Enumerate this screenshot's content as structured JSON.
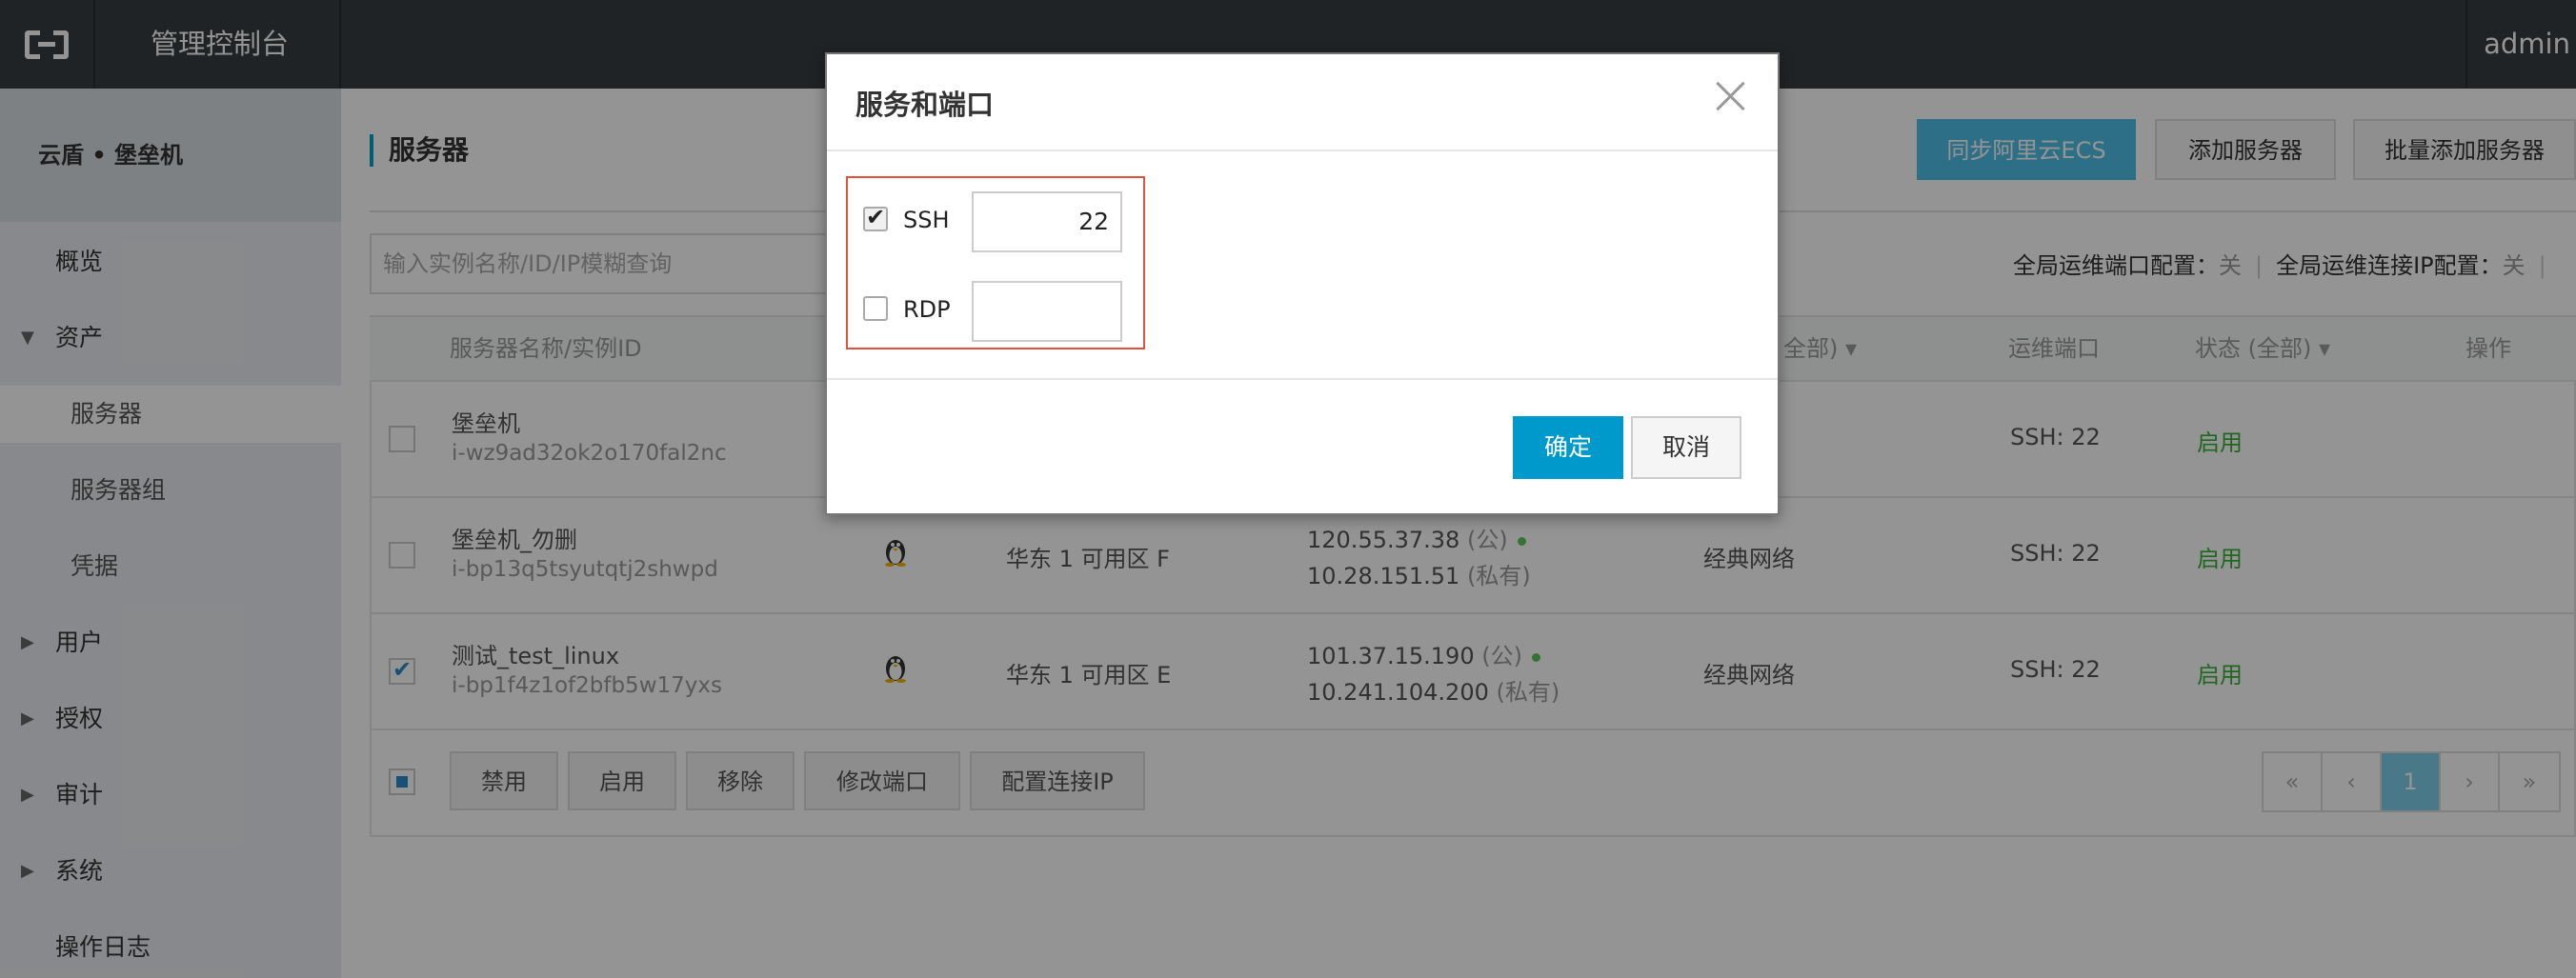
{
  "topbar": {
    "title": "管理控制台",
    "user": "admin"
  },
  "sidebar": {
    "header": "云盾 • 堡垒机",
    "items": [
      {
        "label": "概览"
      },
      {
        "label": "资产",
        "arrow": "▼"
      },
      {
        "label": "服务器"
      },
      {
        "label": "服务器组"
      },
      {
        "label": "凭据"
      },
      {
        "label": "用户",
        "arrow": "▶"
      },
      {
        "label": "授权",
        "arrow": "▶"
      },
      {
        "label": "审计",
        "arrow": "▶"
      },
      {
        "label": "系统",
        "arrow": "▶"
      },
      {
        "label": "操作日志"
      }
    ]
  },
  "main": {
    "title": "服务器",
    "buttons": {
      "sync": "同步阿里云ECS",
      "add": "添加服务器",
      "batch_add": "批量添加服务器"
    },
    "search_placeholder": "输入实例名称/ID/IP模糊查询",
    "config": {
      "port_label": "全局运维端口配置：",
      "port_value": "关",
      "ip_label": "全局运维连接IP配置：",
      "ip_value": "关",
      "sep": "|"
    },
    "columns": {
      "name": "服务器名称/实例ID",
      "network": "全部)",
      "port": "运维端口",
      "status": "状态 (全部)",
      "action": "操作"
    },
    "rows": [
      {
        "name": "堡垒机",
        "id": "i-wz9ad32ok2o170fal2nc",
        "zone": "",
        "ip_public": "",
        "ip_private": "",
        "network": "",
        "port": "SSH: 22",
        "status": "启用"
      },
      {
        "name": "堡垒机_勿删",
        "id": "i-bp13q5tsyutqtj2shwpd",
        "zone": "华东 1 可用区 F",
        "ip_public": "120.55.37.38",
        "ip_public_tag": "(公)",
        "ip_private": "10.28.151.51",
        "ip_private_tag": "(私有)",
        "network": "经典网络",
        "port": "SSH: 22",
        "status": "启用"
      },
      {
        "name": "测试_test_linux",
        "id": "i-bp1f4z1of2bfb5w17yxs",
        "zone": "华东 1 可用区 E",
        "ip_public": "101.37.15.190",
        "ip_public_tag": "(公)",
        "ip_private": "10.241.104.200",
        "ip_private_tag": "(私有)",
        "network": "经典网络",
        "port": "SSH: 22",
        "status": "启用"
      }
    ],
    "footer_buttons": {
      "disable": "禁用",
      "enable": "启用",
      "remove": "移除",
      "edit_port": "修改端口",
      "config_ip": "配置连接IP"
    },
    "pager": {
      "first": "«",
      "prev": "‹",
      "current": "1",
      "next": "›",
      "last": "»"
    }
  },
  "dialog": {
    "title": "服务和端口",
    "ssh_label": "SSH",
    "ssh_port": "22",
    "ssh_checked": true,
    "rdp_label": "RDP",
    "rdp_port": "",
    "rdp_checked": false,
    "ok": "确定",
    "cancel": "取消"
  }
}
